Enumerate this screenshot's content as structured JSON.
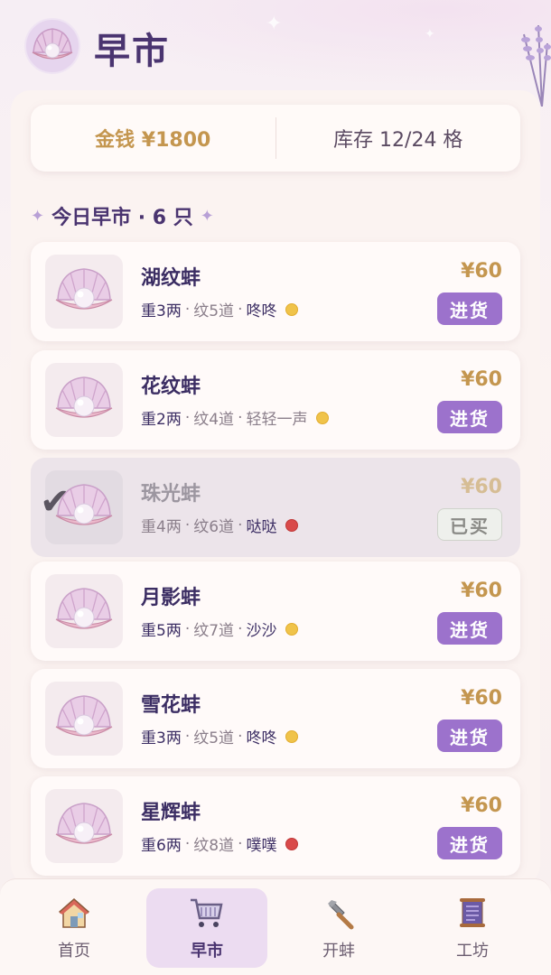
{
  "header": {
    "title": "早市",
    "logo_icon": "pearl-shell-icon"
  },
  "stats": {
    "money": "金钱 ¥1800",
    "inventory": "库存 12/24 格"
  },
  "section": {
    "title": "今日早市 · 6 只",
    "star_icon": "sparkle-icon"
  },
  "items": [
    {
      "name": "湖纹蚌",
      "weight": "重3两",
      "pattern": "纹5道",
      "sound": "咚咚",
      "dot": "gold",
      "price": "¥60",
      "button": "进货",
      "bought": false
    },
    {
      "name": "花纹蚌",
      "weight": "重2两",
      "pattern": "纹4道",
      "sound": "轻轻一声",
      "dot": "gold",
      "price": "¥60",
      "button": "进货",
      "bought": false
    },
    {
      "name": "珠光蚌",
      "weight": "重4两",
      "pattern": "纹6道",
      "sound": "哒哒",
      "dot": "red",
      "price": "¥60",
      "button": "已买",
      "bought": true
    },
    {
      "name": "月影蚌",
      "weight": "重5两",
      "pattern": "纹7道",
      "sound": "沙沙",
      "dot": "gold",
      "price": "¥60",
      "button": "进货",
      "bought": false
    },
    {
      "name": "雪花蚌",
      "weight": "重3两",
      "pattern": "纹5道",
      "sound": "咚咚",
      "dot": "gold",
      "price": "¥60",
      "button": "进货",
      "bought": false
    },
    {
      "name": "星辉蚌",
      "weight": "重6两",
      "pattern": "纹8道",
      "sound": "噗噗",
      "dot": "red",
      "price": "¥60",
      "button": "进货",
      "bought": false
    }
  ],
  "tabs": [
    {
      "label": "首页",
      "icon": "house-icon",
      "active": false
    },
    {
      "label": "早市",
      "icon": "shopping-cart-icon",
      "active": true
    },
    {
      "label": "开蚌",
      "icon": "hammer-icon",
      "active": false
    },
    {
      "label": "工坊",
      "icon": "scroll-icon",
      "active": false
    }
  ],
  "colors": {
    "accent": "#9c72cc",
    "title": "#4a3470",
    "gold_text": "#c4964f",
    "dot_gold": "#f0c34a",
    "dot_red": "#d94a4a"
  }
}
